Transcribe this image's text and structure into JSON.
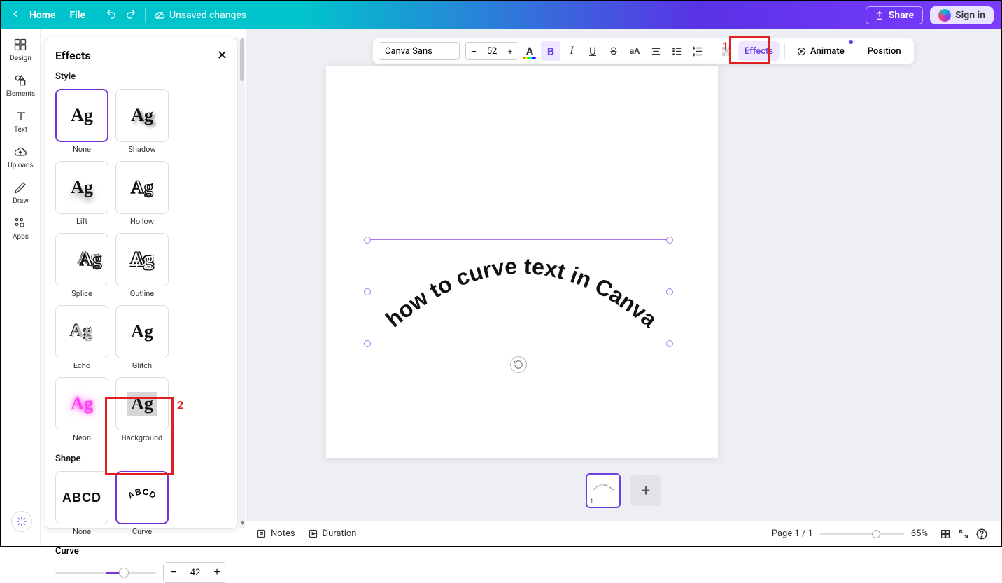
{
  "topbar": {
    "home": "Home",
    "file": "File",
    "unsaved": "Unsaved changes",
    "share": "Share",
    "signin": "Sign in"
  },
  "leftrail": {
    "design": "Design",
    "elements": "Elements",
    "text": "Text",
    "uploads": "Uploads",
    "draw": "Draw",
    "apps": "Apps"
  },
  "panel": {
    "title": "Effects",
    "style_heading": "Style",
    "styles": {
      "none": "None",
      "shadow": "Shadow",
      "lift": "Lift",
      "hollow": "Hollow",
      "splice": "Splice",
      "outline": "Outline",
      "echo": "Echo",
      "glitch": "Glitch",
      "neon": "Neon",
      "background": "Background"
    },
    "shape_heading": "Shape",
    "shapes": {
      "none": "None",
      "curve": "Curve"
    },
    "curve_label": "Curve",
    "curve_value": "42"
  },
  "toolbar": {
    "font": "Canva Sans",
    "size": "52",
    "effects": "Effects",
    "animate": "Animate",
    "position": "Position"
  },
  "canvas": {
    "text": "how to curve text in Canva",
    "page_thumb_number": "1"
  },
  "bottom": {
    "notes": "Notes",
    "duration": "Duration",
    "page_indicator": "Page 1 / 1",
    "zoom": "65%"
  },
  "annotations": {
    "one": "1",
    "two": "2"
  }
}
